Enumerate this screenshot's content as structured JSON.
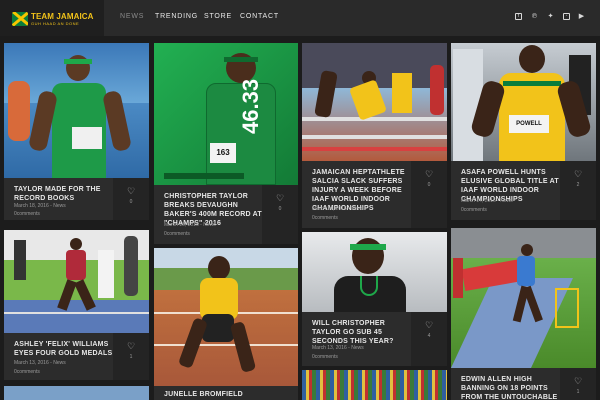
{
  "brand": {
    "title": "TEAM JAMAICA",
    "tagline": "GUH HAAD AN DONE"
  },
  "nav": {
    "items": [
      "NEWS",
      "TRENDING",
      "STORE",
      "CONTACT"
    ]
  },
  "social_icons": [
    "facebook-icon",
    "pinterest-icon",
    "twitter-icon",
    "instagram-icon",
    "youtube-icon"
  ],
  "colors": {
    "gold": "#f2c31a",
    "green": "#0a7d3c",
    "dark": "#2c2c2c"
  },
  "cards": [
    {
      "title": "TAYLOR MADE FOR THE RECORD BOOKS",
      "date": "March 18, 2016",
      "category": "News",
      "comments": "0comments",
      "likes": "0"
    },
    {
      "title": "CHRISTOPHER TAYLOR BREAKS DEVAUGHN BAKER'S 400M RECORD AT \"CHAMPS\" 2016",
      "date": "March 16, 2016",
      "category": "News",
      "comments": "0comments",
      "likes": "0",
      "photo_number": "46.33",
      "bib": "163"
    },
    {
      "title": "JAMAICAN HEPTATHLETE SALCIA SLACK SUFFERS INJURY A WEEK BEFORE IAAF WORLD INDOOR CHAMPIONSHIPS",
      "date": "March 14, 2016",
      "category": "News",
      "comments": "0comments",
      "likes": "0"
    },
    {
      "title": "ASAFA POWELL HUNTS ELUSIVE GLOBAL TITLE AT IAAF WORLD INDOOR CHAMPIONSHIPS",
      "date": "March 14, 2016",
      "category": "News",
      "comments": "0comments",
      "likes": "2",
      "bib": "POWELL"
    },
    {
      "title": "ASHLEY 'FELIX' WILLIAMS EYES FOUR GOLD MEDALS",
      "date": "March 13, 2016",
      "category": "News",
      "comments": "0comments",
      "likes": "1"
    },
    {
      "title": "JUNELLE BROMFIELD",
      "date": "",
      "category": "",
      "comments": "",
      "likes": ""
    },
    {
      "title": "WILL CHRISTOPHER TAYLOR GO SUB 45 SECONDS THIS YEAR?",
      "date": "March 13, 2016",
      "category": "News",
      "comments": "0comments",
      "likes": "4"
    },
    {
      "title": "EDWIN ALLEN HIGH BANNING ON 18 POINTS FROM THE UNTOUCHABLE",
      "date": "",
      "category": "",
      "comments": "",
      "likes": "1"
    }
  ],
  "sep": "-"
}
